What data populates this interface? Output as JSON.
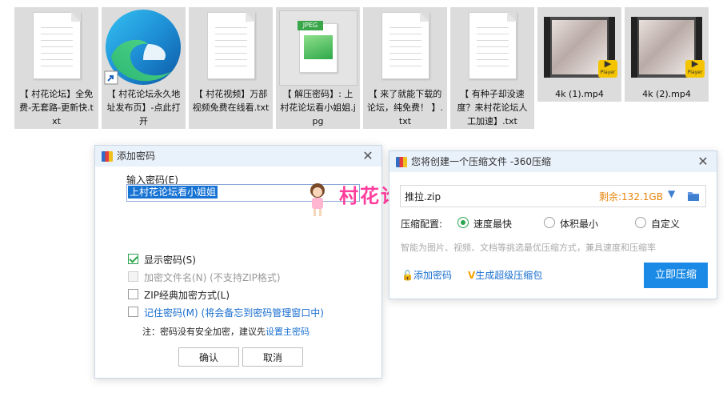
{
  "files": [
    {
      "name": "【 村花论坛】全免费-无套路-更新快.txt",
      "type": "txt"
    },
    {
      "name": "【 村花论坛永久地址发布页】-点此打开",
      "type": "edge-shortcut"
    },
    {
      "name": "【 村花视频】万部视频免费在线看.txt",
      "type": "txt"
    },
    {
      "name": "【 解压密码】: 上村花论坛看小姐姐.jpg",
      "type": "jpg",
      "badge": "JPEG"
    },
    {
      "name": "【 来了就能下载的论坛，纯免费！ 】.txt",
      "type": "txt"
    },
    {
      "name": "【 有种子却没速度？来村花论坛人工加速】.txt",
      "type": "txt"
    },
    {
      "name": "4k (1).mp4",
      "type": "mp4",
      "badge": "Player"
    },
    {
      "name": "4k (2).mp4",
      "type": "mp4",
      "badge": "Player"
    }
  ],
  "password_dialog": {
    "title": "添加密码",
    "input_label": "输入密码(E)",
    "password_value": "上村花论坛看小姐姐",
    "show_password": {
      "label": "显示密码(S)",
      "checked": true
    },
    "encrypt_names": {
      "label": "加密文件名(N) (不支持ZIP格式)",
      "checked": false,
      "disabled": true
    },
    "zip_classic": {
      "label": "ZIP经典加密方式(L)",
      "checked": false
    },
    "remember": {
      "label": "记住密码(M) (将会备忘到密码管理窗口中)",
      "checked": false
    },
    "note_prefix": "注：密码没有安全加密，建议先",
    "note_link": "设置主密码",
    "ok": "确认",
    "cancel": "取消"
  },
  "compress_dialog": {
    "title": "您将创建一个压缩文件 -360压缩",
    "filename": "推拉.zip",
    "free_space": "剩余:132.1GB",
    "config_label": "压缩配置:",
    "options": [
      {
        "label": "速度最快",
        "selected": true
      },
      {
        "label": "体积最小",
        "selected": false
      },
      {
        "label": "自定义",
        "selected": false
      }
    ],
    "hint": "智能为图片、视频、文档等挑选最优压缩方式，兼具速度和压缩率",
    "add_password": "添加密码",
    "super_zip": "生成超级压缩包",
    "compress_now": "立即压缩"
  },
  "watermark": "村花论坛",
  "colors": {
    "accent": "#1a8ae6",
    "link": "#1a6fd0",
    "orange": "#e8850c",
    "success": "#2da44e",
    "watermark": "#ff3e9e"
  },
  "icons": {
    "close": "close-icon",
    "folder": "folder-icon",
    "dropdown": "chevron-down-icon",
    "lock": "lock-icon"
  }
}
